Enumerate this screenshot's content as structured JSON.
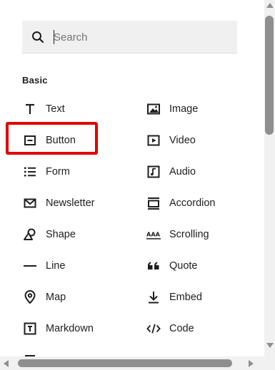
{
  "search": {
    "placeholder": "Search",
    "value": ""
  },
  "section": {
    "title": "Basic"
  },
  "blocks": {
    "text": "Text",
    "image": "Image",
    "button": "Button",
    "video": "Video",
    "form": "Form",
    "audio": "Audio",
    "newsletter": "Newsletter",
    "accordion": "Accordion",
    "shape": "Shape",
    "scrolling": "Scrolling",
    "line": "Line",
    "quote": "Quote",
    "map": "Map",
    "embed": "Embed",
    "markdown": "Markdown",
    "code": "Code"
  },
  "icons": {
    "search": "search-icon",
    "text": "text-t-icon",
    "image": "image-icon",
    "button": "button-icon",
    "video": "video-play-icon",
    "form": "form-list-icon",
    "audio": "audio-note-icon",
    "newsletter": "envelope-icon",
    "accordion": "accordion-icon",
    "shape": "shape-icon",
    "scrolling": "scrolling-text-icon",
    "line": "line-icon",
    "quote": "quote-icon",
    "map": "map-pin-icon",
    "embed": "embed-download-icon",
    "markdown": "markdown-icon",
    "code": "code-icon"
  },
  "colors": {
    "highlight": "#e00000",
    "search_bg": "#f0f0f0",
    "text": "#1e1e1e"
  }
}
